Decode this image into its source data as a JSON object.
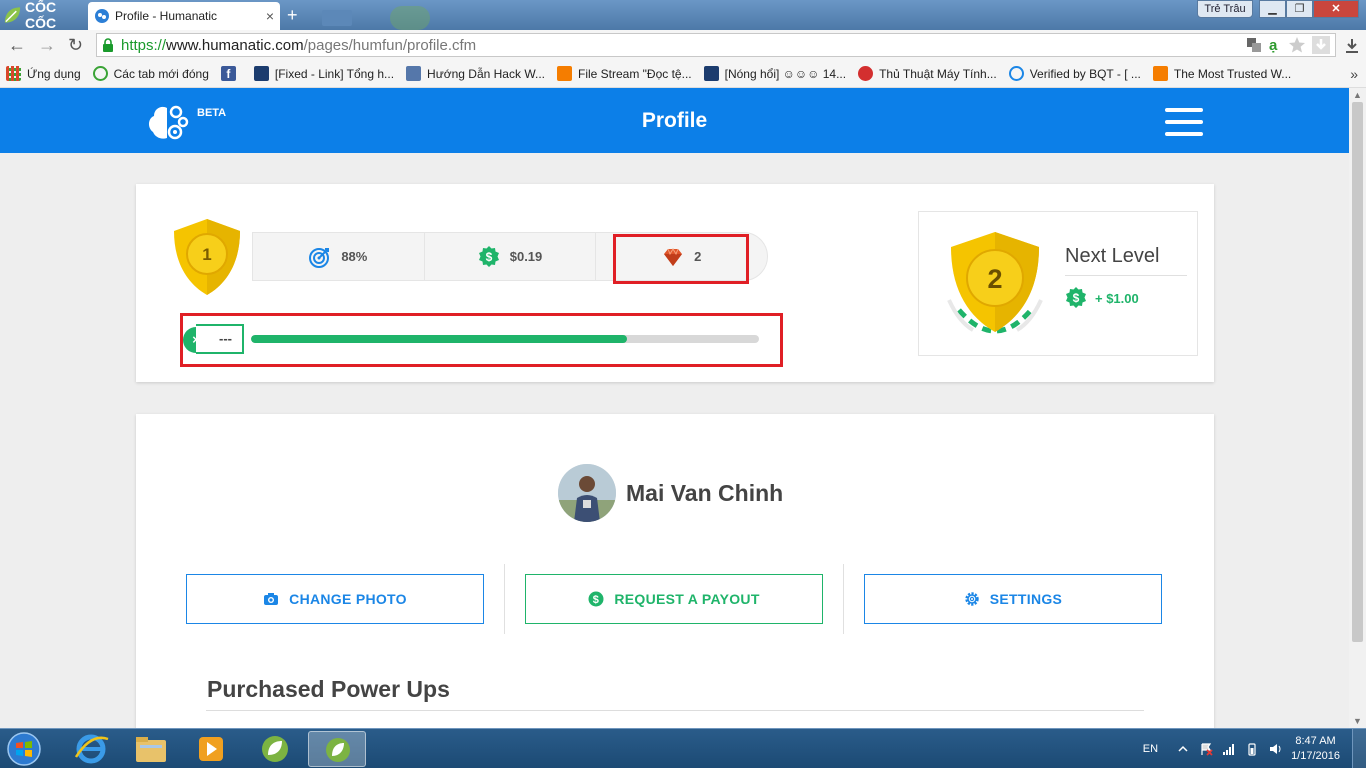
{
  "browser": {
    "brand": "CỐC CỐC",
    "tab_title": "Profile - Humanatic",
    "tab_close": "×",
    "new_tab": "+",
    "user_name": "Trẻ Trâu",
    "window_controls": {
      "minimize": "▁",
      "maximize": "❐",
      "close": "✕"
    },
    "nav": {
      "back": "←",
      "forward": "→",
      "reload": "↻"
    },
    "url": {
      "scheme": "https://",
      "host": "www.humanatic.com",
      "path": "/pages/humfun/profile.cfm"
    },
    "bookmarks_overflow": "»",
    "bookmarks": [
      {
        "label": "Ứng dụng",
        "icon": "apps-grid-icon",
        "color": "#d9482b"
      },
      {
        "label": "Các tab mới đóng",
        "icon": "history-icon",
        "color": "#3aa336"
      },
      {
        "label": "",
        "icon": "facebook-icon",
        "color": "#3b5998"
      },
      {
        "label": "[Fixed - Link] Tổng h...",
        "icon": "vforum-icon",
        "color": "#1c3c6e"
      },
      {
        "label": "Hướng Dẫn Hack W...",
        "icon": "page-icon",
        "color": "#5577aa"
      },
      {
        "label": "File Stream \"Đọc tệ...",
        "icon": "blogger-icon",
        "color": "#f57d00"
      },
      {
        "label": "[Nóng hổi] ☺☺☺ 14...",
        "icon": "vforum-icon",
        "color": "#1c3c6e"
      },
      {
        "label": "Thủ Thuật Máy Tính...",
        "icon": "red-ball-icon",
        "color": "#d32f2f"
      },
      {
        "label": "Verified by BQT - [ ...",
        "icon": "dollar-circle-icon",
        "color": "#1b86e6"
      },
      {
        "label": "The Most Trusted W...",
        "icon": "blogger-icon",
        "color": "#f57d00"
      }
    ]
  },
  "site": {
    "badge": "BETA",
    "title": "Profile",
    "colors": {
      "brand_blue": "#0c7fe8",
      "green": "#1fb46a",
      "gold": "#f5c400",
      "highlight_red": "#e01f25"
    },
    "current_level": "1",
    "stats": [
      {
        "icon": "target-icon",
        "value": "88%"
      },
      {
        "icon": "dollar-coin-icon",
        "value": "$0.19"
      },
      {
        "icon": "ruby-gem-icon",
        "value": "2"
      }
    ],
    "progress": {
      "close_label": "×",
      "label": "---",
      "fraction": 0.74
    },
    "next_level": {
      "level": "2",
      "title": "Next Level",
      "reward": "+ $1.00"
    },
    "profile": {
      "name": "Mai Van Chinh",
      "buttons": {
        "change_photo": "CHANGE PHOTO",
        "request_payout": "REQUEST A PAYOUT",
        "settings": "SETTINGS"
      },
      "section_title": "Purchased Power Ups"
    }
  },
  "taskbar": {
    "apps": [
      "internet-explorer-icon",
      "explorer-folder-icon",
      "media-player-icon",
      "coccoc-icon",
      "coccoc-window-icon"
    ],
    "language": "EN",
    "time": "8:47 AM",
    "date": "1/17/2016"
  }
}
